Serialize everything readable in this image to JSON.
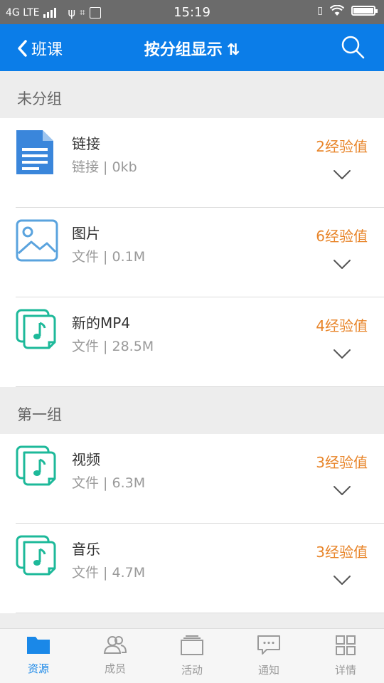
{
  "status_bar": {
    "network": "4G LTE",
    "time": "15:19"
  },
  "header": {
    "back_label": "班课",
    "title": "按分组显示",
    "sort_glyph": "⇅"
  },
  "groups": [
    {
      "name": "未分组",
      "items": [
        {
          "name": "链接",
          "meta": "链接 | 0kb",
          "exp": "2经验值",
          "icon": "document-icon"
        },
        {
          "name": "图片",
          "meta": "文件 | 0.1M",
          "exp": "6经验值",
          "icon": "image-icon"
        },
        {
          "name": "新的MP4",
          "meta": "文件 | 28.5M",
          "exp": "4经验值",
          "icon": "music-file-icon"
        }
      ]
    },
    {
      "name": "第一组",
      "items": [
        {
          "name": "视频",
          "meta": "文件 | 6.3M",
          "exp": "3经验值",
          "icon": "music-file-icon"
        },
        {
          "name": "音乐",
          "meta": "文件 | 4.7M",
          "exp": "3经验值",
          "icon": "music-file-icon"
        }
      ]
    }
  ],
  "tabs": [
    {
      "label": "资源",
      "icon": "folder-icon",
      "active": true
    },
    {
      "label": "成员",
      "icon": "members-icon",
      "active": false
    },
    {
      "label": "活动",
      "icon": "activity-icon",
      "active": false
    },
    {
      "label": "通知",
      "icon": "message-icon",
      "active": false
    },
    {
      "label": "详情",
      "icon": "grid-icon",
      "active": false
    }
  ],
  "colors": {
    "header_bg": "#0b7de8",
    "exp_orange": "#e8852a",
    "tab_active": "#1a88e8"
  }
}
